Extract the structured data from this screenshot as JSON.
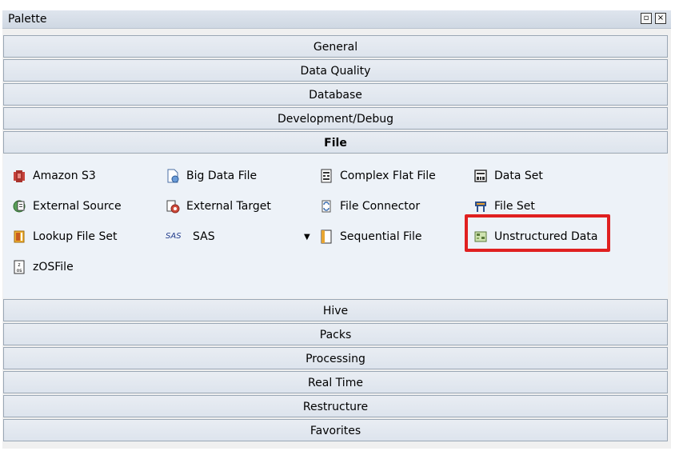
{
  "window": {
    "title": "Palette",
    "restore_glyph": "▫",
    "close_glyph": "×"
  },
  "categories_top": [
    "General",
    "Data Quality",
    "Database",
    "Development/Debug",
    "File"
  ],
  "active_category": "File",
  "file_items": [
    {
      "label": "Amazon S3",
      "icon": "amazon-s3-icon"
    },
    {
      "label": "Big Data File",
      "icon": "big-data-file-icon"
    },
    {
      "label": "Complex Flat File",
      "icon": "complex-flat-file-icon"
    },
    {
      "label": "Data Set",
      "icon": "data-set-icon"
    },
    {
      "label": "External Source",
      "icon": "external-source-icon"
    },
    {
      "label": "External Target",
      "icon": "external-target-icon"
    },
    {
      "label": "File Connector",
      "icon": "file-connector-icon"
    },
    {
      "label": "File Set",
      "icon": "file-set-icon"
    },
    {
      "label": "Lookup File Set",
      "icon": "lookup-file-set-icon"
    },
    {
      "label": "SAS",
      "icon_text": "SAS",
      "icon": "sas-icon"
    },
    {
      "label": "Sequential File",
      "icon": "sequential-file-icon"
    },
    {
      "label": "Unstructured Data",
      "icon": "unstructured-data-icon"
    },
    {
      "label": "zOSFile",
      "icon": "zos-file-icon"
    }
  ],
  "categories_bottom": [
    "Hive",
    "Packs",
    "Processing",
    "Real Time",
    "Restructure",
    "Favorites"
  ],
  "colors": {
    "highlight": "#e02020"
  }
}
